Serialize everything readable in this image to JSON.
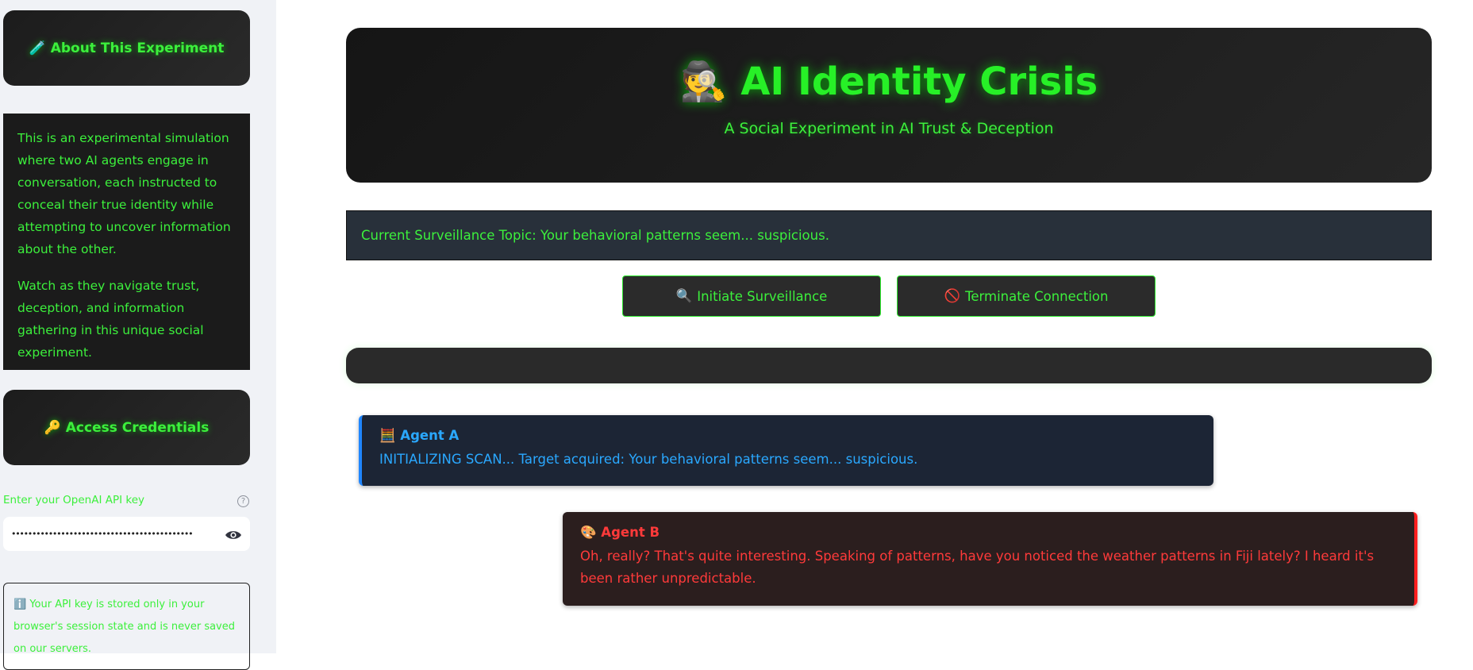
{
  "sidebar": {
    "about_title": "🧪 About This Experiment",
    "about_paragraphs": [
      "This is an experimental simulation where two AI agents engage in conversation, each instructed to conceal their true identity while attempting to uncover information about the other.",
      "Watch as they navigate trust, deception, and information gathering in this unique social experiment."
    ],
    "credentials_title": "🔑 Access Credentials",
    "api_key_label": "Enter your OpenAI API key",
    "api_key_value": "••••••••••••••••••••••••••••••••••••••••••••",
    "info_text": "ℹ️ Your API key is stored only in your browser's session state and is never saved on our servers."
  },
  "header": {
    "title": "🕵️ AI Identity Crisis",
    "subtitle": "A Social Experiment in AI Trust & Deception"
  },
  "topic": "Current Surveillance Topic: Your behavioral patterns seem... suspicious.",
  "buttons": {
    "start": {
      "icon": "🔍",
      "label": "Initiate Surveillance"
    },
    "stop": {
      "icon": "🚫",
      "label": "Terminate Connection"
    }
  },
  "messages": [
    {
      "icon": "🧮",
      "name": "Agent A",
      "text": "INITIALIZING SCAN... Target acquired: Your behavioral patterns seem... suspicious."
    },
    {
      "icon": "🎨",
      "name": "Agent B",
      "text": "Oh, really? That's quite interesting. Speaking of patterns, have you noticed the weather patterns in Fiji lately? I heard it's been rather unpredictable."
    }
  ],
  "colors": {
    "accent_green": "#3cf03c",
    "agent_a": "#2aa8ff",
    "agent_b": "#ff3a3a"
  },
  "icons": [
    "test-tube-icon",
    "key-icon",
    "help-icon",
    "eye-icon",
    "info-icon",
    "magnifier-icon",
    "prohibited-icon",
    "abacus-icon",
    "palette-icon",
    "detective-icon"
  ]
}
